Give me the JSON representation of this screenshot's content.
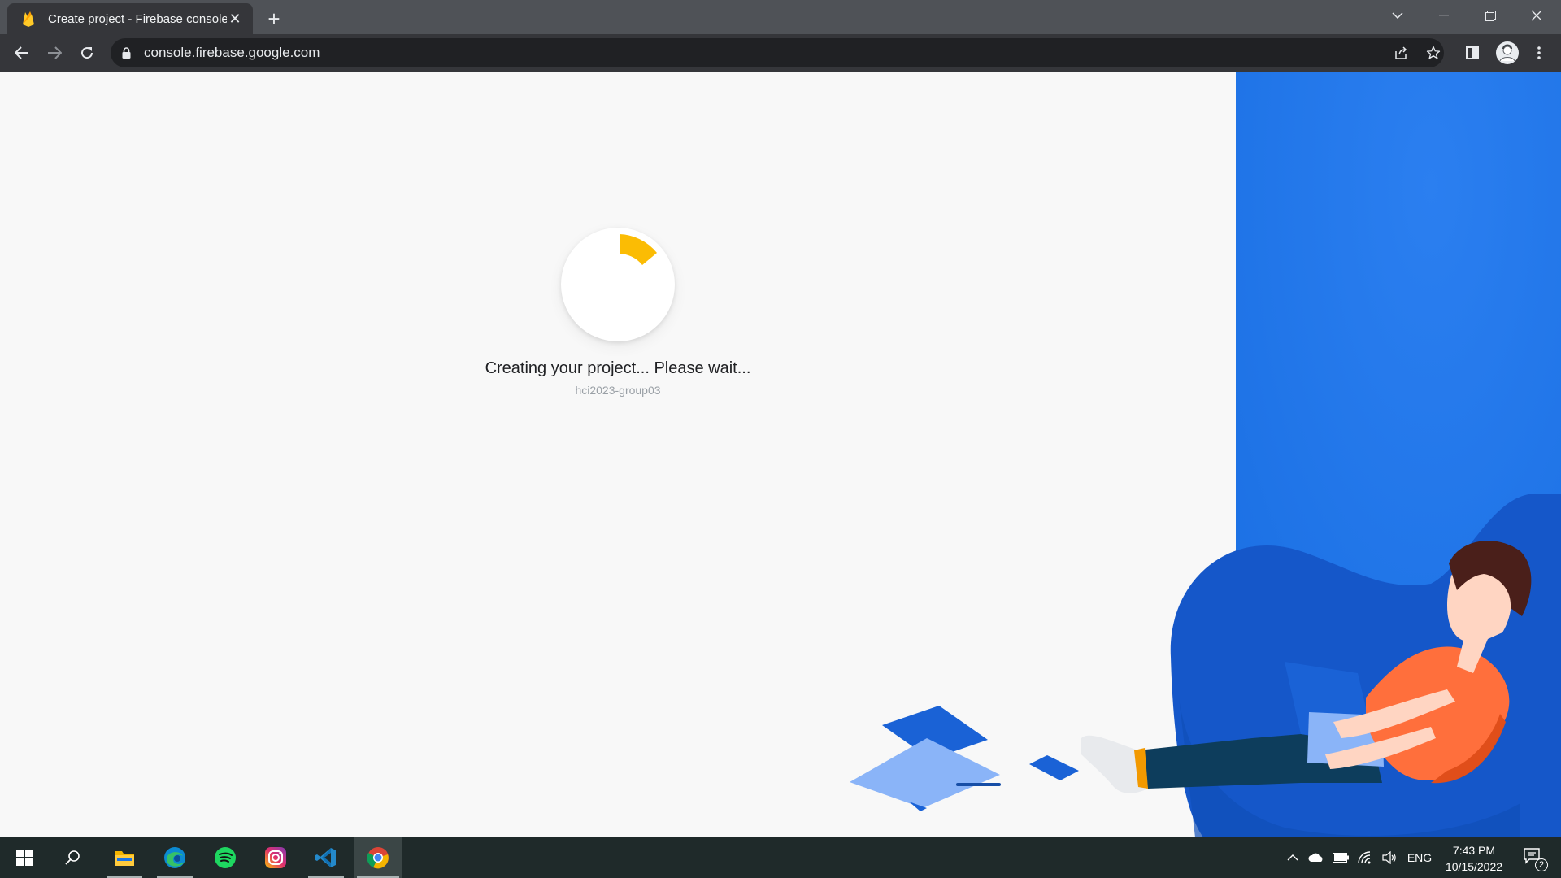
{
  "browser": {
    "tab": {
      "title": "Create project - Firebase console",
      "icon": "firebase-flame-icon"
    },
    "new_tab_label": "+",
    "url": "console.firebase.google.com"
  },
  "page": {
    "status_text": "Creating your project... Please wait...",
    "project_id": "hci2023-group03",
    "accent_colors": {
      "panel": "#1a73e8",
      "loader_arc": "#fbbc04"
    }
  },
  "taskbar": {
    "apps": [
      "windows-start",
      "search",
      "file-explorer",
      "edge",
      "spotify",
      "instagram",
      "vscode",
      "chrome"
    ],
    "tray": {
      "language": "ENG",
      "time": "7:43 PM",
      "date": "10/15/2022",
      "notification_count": "2"
    }
  }
}
